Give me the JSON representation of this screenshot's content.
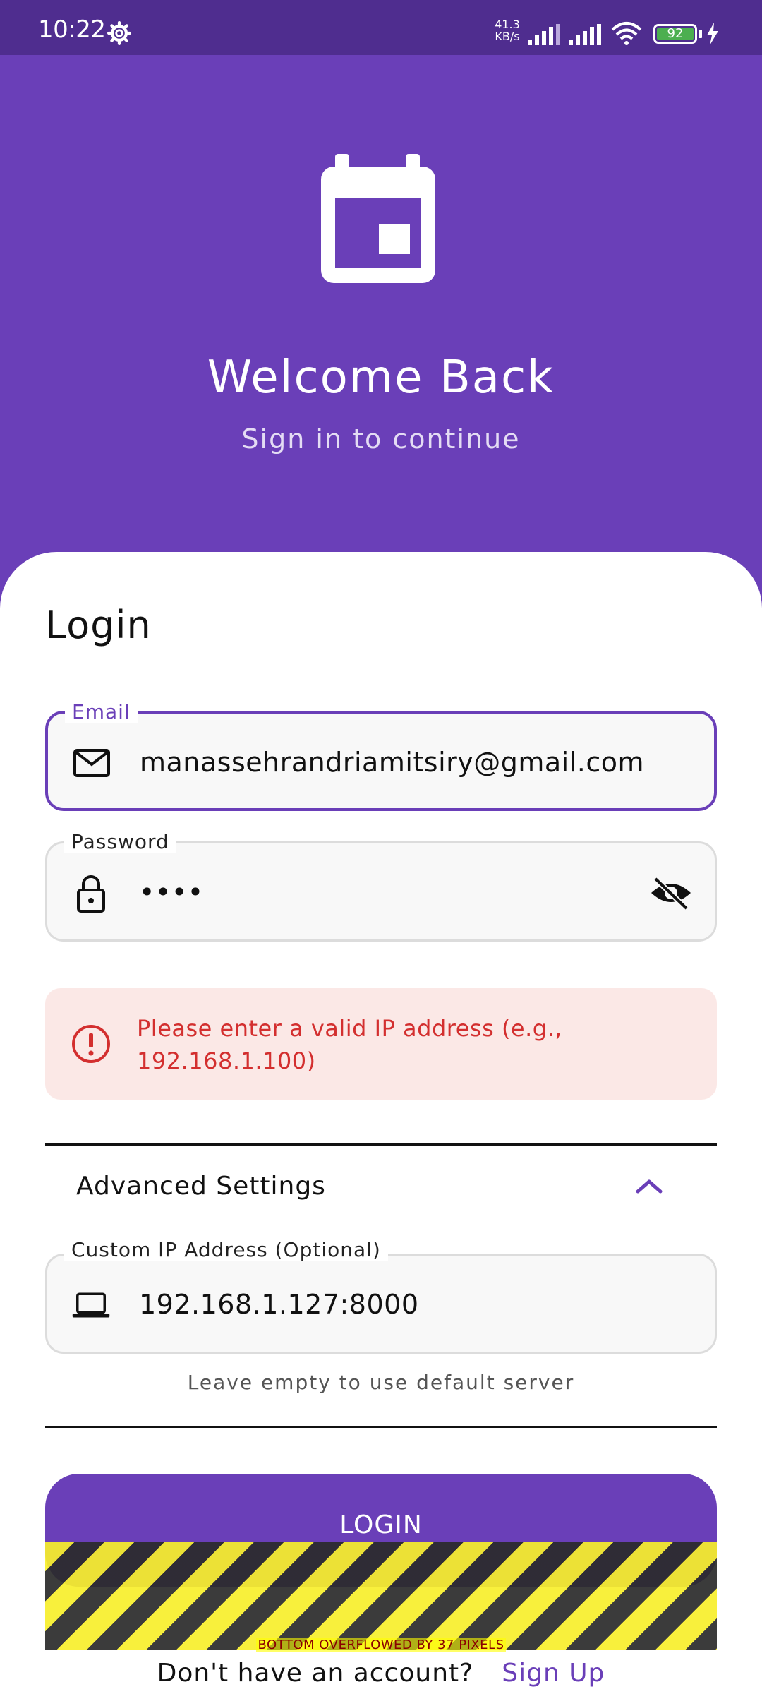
{
  "status_bar": {
    "time": "10:22",
    "network_speed": "41.3",
    "network_speed_unit": "KB/s",
    "battery_level": "92",
    "icons": [
      "gear-icon",
      "signal-icon",
      "signal-icon",
      "wifi-icon",
      "battery-icon",
      "charging-bolt-icon"
    ]
  },
  "hero": {
    "icon": "calendar-icon",
    "title": "Welcome Back",
    "subtitle": "Sign in to continue"
  },
  "login_card": {
    "title": "Login",
    "email": {
      "label": "Email",
      "value": "manassehrandriamitsiry@gmail.com",
      "icon": "mail-icon"
    },
    "password": {
      "label": "Password",
      "value": "••••",
      "icon": "lock-icon",
      "toggle_icon": "visibility-off-icon"
    },
    "error": {
      "icon": "error-icon",
      "message": "Please enter a valid IP address (e.g., 192.168.1.100)"
    },
    "advanced": {
      "title": "Advanced Settings",
      "icon": "chevron-up-icon",
      "custom_ip": {
        "label": "Custom IP Address (Optional)",
        "value": "192.168.1.127:8000",
        "icon": "laptop-icon"
      },
      "helper": "Leave empty to use default server"
    },
    "login_button": "LOGIN",
    "overflow_warning": "BOTTOM OVERFLOWED BY 37 PIXELS",
    "signup_prompt": "Don't have an account?",
    "signup_link": "Sign Up"
  },
  "colors": {
    "primary": "#6a3fb8",
    "status_bar": "#4f2d8f",
    "error": "#d32f2f",
    "error_bg": "#fbe8e6"
  }
}
